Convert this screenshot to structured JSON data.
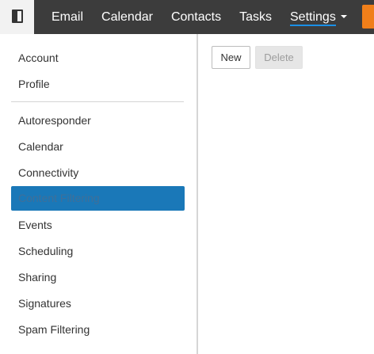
{
  "topnav": {
    "items": [
      "Email",
      "Calendar",
      "Contacts",
      "Tasks"
    ],
    "settings_label": "Settings"
  },
  "sidebar": {
    "group1": [
      "Account",
      "Profile"
    ],
    "group2": [
      "Autoresponder",
      "Calendar",
      "Connectivity",
      "Content Filtering",
      "Events",
      "Scheduling",
      "Sharing",
      "Signatures",
      "Spam Filtering"
    ],
    "selected": "Content Filtering"
  },
  "toolbar": {
    "new_label": "New",
    "delete_label": "Delete"
  },
  "colors": {
    "topbar": "#3c3c3c",
    "selected_bg": "#1a78b8",
    "accent_underline": "#1a8fe6",
    "orange": "#f07f1a"
  }
}
